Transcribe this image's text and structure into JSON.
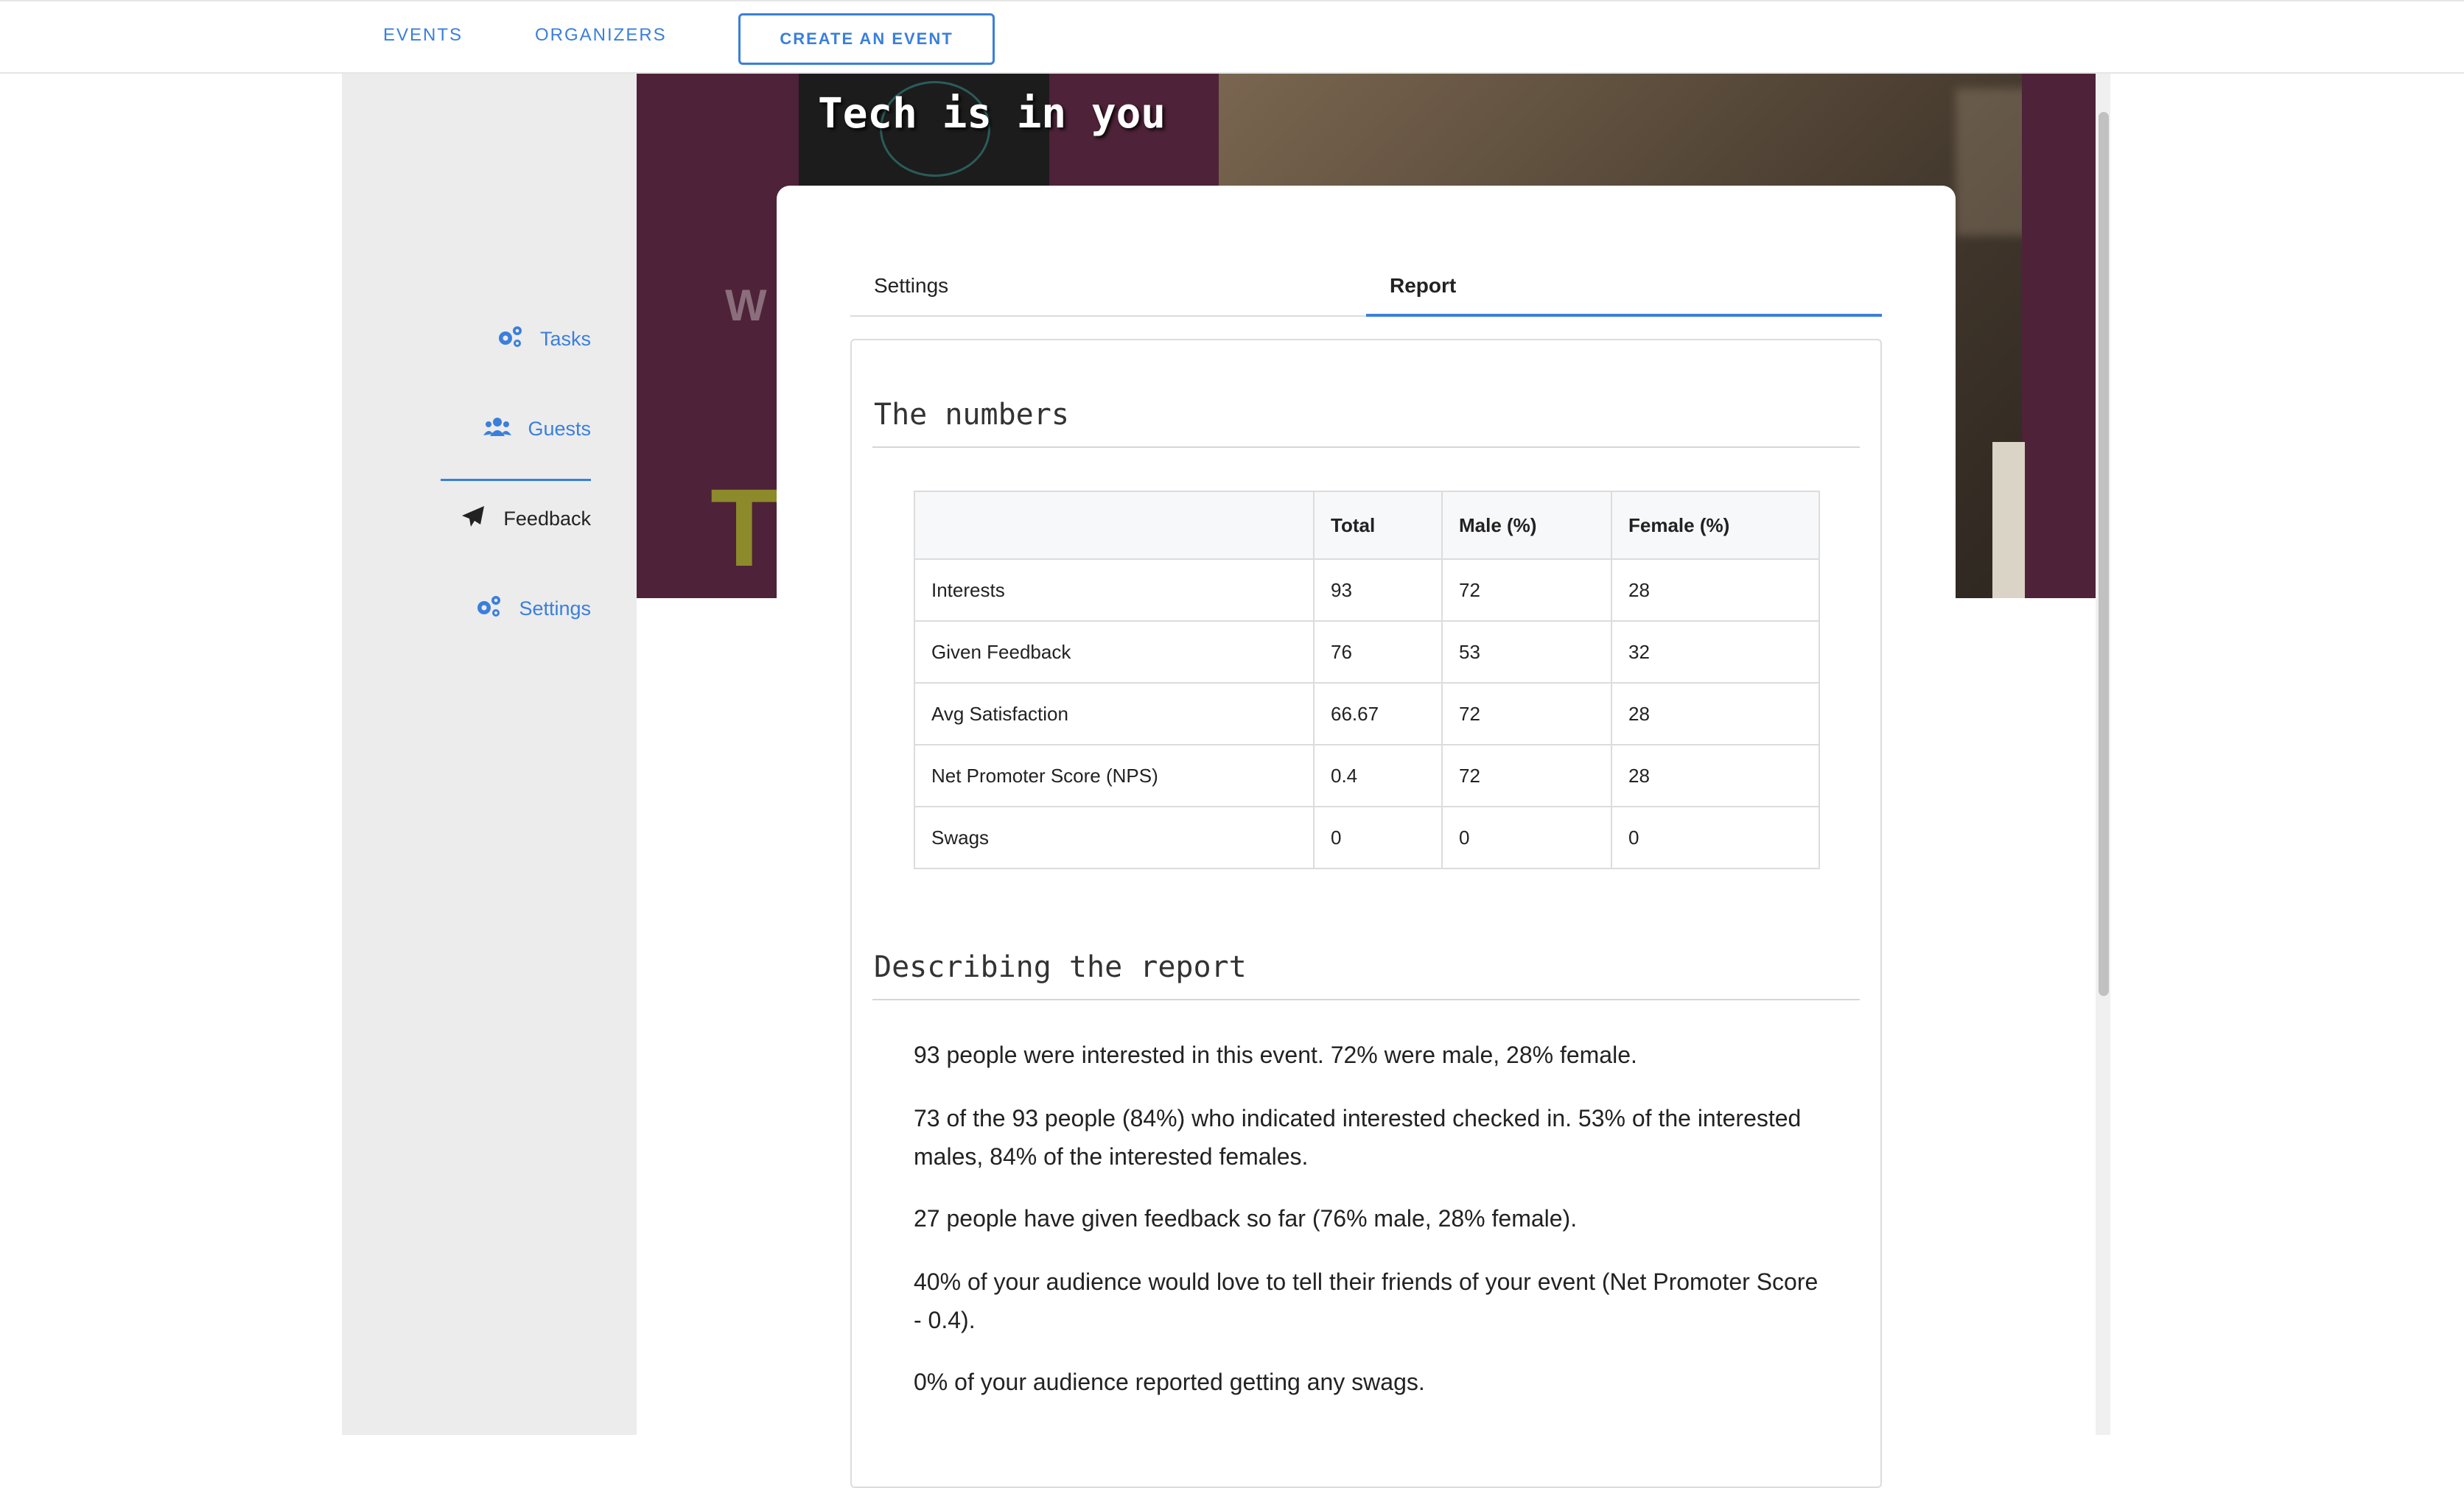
{
  "topnav": {
    "events": "EVENTS",
    "organizers": "ORGANIZERS",
    "create_event": "CREATE AN EVENT"
  },
  "sidebar": {
    "items": [
      {
        "label": "Tasks",
        "icon": "gears-icon"
      },
      {
        "label": "Guests",
        "icon": "users-icon"
      },
      {
        "label": "Feedback",
        "icon": "paper-plane-icon"
      },
      {
        "label": "Settings",
        "icon": "gears-icon"
      }
    ],
    "active": "Feedback"
  },
  "hero": {
    "title": "Tech is in you"
  },
  "tabs": {
    "settings": "Settings",
    "report": "Report",
    "active": "Report"
  },
  "numbers": {
    "title": "The numbers",
    "headers": [
      "",
      "Total",
      "Male (%)",
      "Female (%)"
    ],
    "rows": [
      {
        "label": "Interests",
        "total": "93",
        "male": "72",
        "female": "28"
      },
      {
        "label": "Given Feedback",
        "total": "76",
        "male": "53",
        "female": "32"
      },
      {
        "label": "Avg Satisfaction",
        "total": "66.67",
        "male": "72",
        "female": "28"
      },
      {
        "label": "Net Promoter Score (NPS)",
        "total": "0.4",
        "male": "72",
        "female": "28"
      },
      {
        "label": "Swags",
        "total": "0",
        "male": "0",
        "female": "0"
      }
    ]
  },
  "report": {
    "title": "Describing the report",
    "paragraphs": [
      "93 people were interested in this event. 72% were male, 28% female.",
      "73 of the 93 people (84%) who indicated interested checked in. 53% of the interested males, 84% of the interested females.",
      "27 people have given feedback so far (76% male, 28% female).",
      "40% of your audience would love to tell their friends of your event (Net Promoter Score - 0.4).",
      "0% of your audience reported getting any swags."
    ]
  },
  "colors": {
    "accent": "#3a7fdc",
    "hero_bg": "#4e2238"
  }
}
